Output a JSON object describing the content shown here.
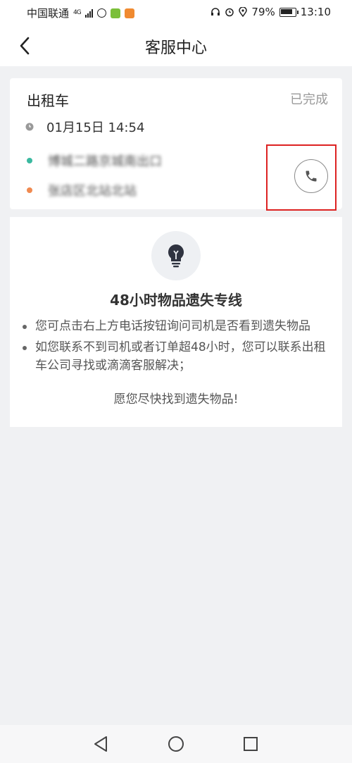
{
  "status_bar": {
    "carrier": "中国联通",
    "network": "4G",
    "battery": "79%",
    "time": "13:10"
  },
  "nav": {
    "title": "客服中心"
  },
  "order": {
    "type": "出租车",
    "status": "已完成",
    "time": "01月15日 14:54",
    "from": "博城二路京城南出口",
    "to": "张店区北站北站",
    "from_color": "#3bb9a0",
    "to_color": "#f08a50"
  },
  "info": {
    "title": "48小时物品遗失专线",
    "items": [
      "您可点击右上方电话按钮询问司机是否看到遗失物品",
      "如您联系不到司机或者订单超48小时，您可以联系出租车公司寻找或滴滴客服解决；"
    ],
    "footer": "愿您尽快找到遗失物品!"
  },
  "colors": {
    "background": "#f0f1f3",
    "highlight": "#dd2222"
  }
}
